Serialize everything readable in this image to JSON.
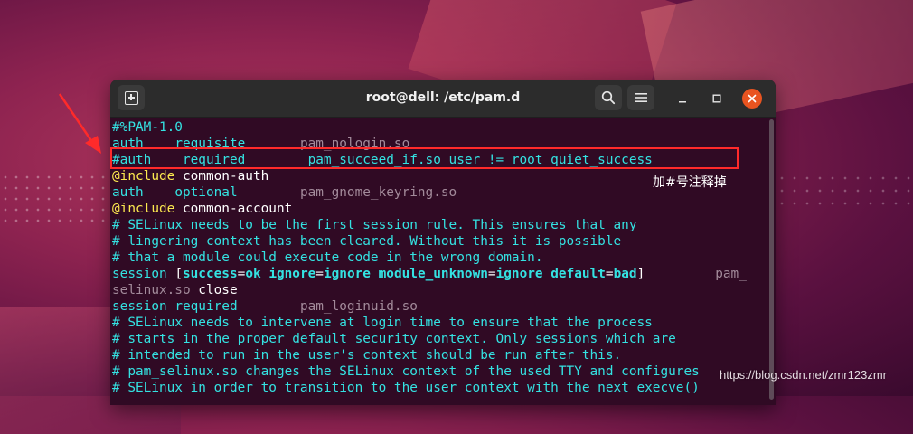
{
  "window": {
    "title": "root@dell: /etc/pam.d"
  },
  "icons": {
    "new_tab": "new-tab-icon",
    "search": "search-icon",
    "menu": "hamburger-menu-icon",
    "minimize": "minimize-icon",
    "maximize": "maximize-icon",
    "close": "close-icon"
  },
  "colors": {
    "terminal_bg": "#300a24",
    "cyan": "#34e2e2",
    "highlight_box": "#ff2a2a",
    "close_button": "#e95420"
  },
  "terminal": {
    "lines": [
      [
        {
          "t": "#%PAM-1.0",
          "c": "comment"
        }
      ],
      [
        {
          "t": "auth    ",
          "c": "kw"
        },
        {
          "t": "requisite       ",
          "c": "kw"
        },
        {
          "t": "pam_nologin.so",
          "c": "dim"
        }
      ],
      [
        {
          "t": "#auth    required        pam_succeed_if.so user != root quiet_success",
          "c": "comment"
        }
      ],
      [
        {
          "t": "@include",
          "c": "yellow"
        },
        {
          "t": " common-auth",
          "c": "white"
        }
      ],
      [
        {
          "t": "auth    ",
          "c": "kw"
        },
        {
          "t": "optional        ",
          "c": "kw"
        },
        {
          "t": "pam_gnome_keyring.so",
          "c": "dim"
        }
      ],
      [
        {
          "t": "@include",
          "c": "yellow"
        },
        {
          "t": " common-account",
          "c": "white"
        }
      ],
      [
        {
          "t": "# SELinux needs to be the first session rule. This ensures that any",
          "c": "comment"
        }
      ],
      [
        {
          "t": "# lingering context has been cleared. Without this it is possible",
          "c": "comment"
        }
      ],
      [
        {
          "t": "# that a module could execute code in the wrong domain.",
          "c": "comment"
        }
      ],
      [
        {
          "t": "session ",
          "c": "kw"
        },
        {
          "t": "[",
          "c": "white"
        },
        {
          "t": "success",
          "c": "kwb"
        },
        {
          "t": "=",
          "c": "white"
        },
        {
          "t": "ok",
          "c": "kwb"
        },
        {
          "t": " ",
          "c": "white"
        },
        {
          "t": "ignore",
          "c": "kwb"
        },
        {
          "t": "=",
          "c": "white"
        },
        {
          "t": "ignore",
          "c": "kwb"
        },
        {
          "t": " ",
          "c": "white"
        },
        {
          "t": "module_unknown",
          "c": "kwb"
        },
        {
          "t": "=",
          "c": "white"
        },
        {
          "t": "ignore",
          "c": "kwb"
        },
        {
          "t": " ",
          "c": "white"
        },
        {
          "t": "default",
          "c": "kwb"
        },
        {
          "t": "=",
          "c": "white"
        },
        {
          "t": "bad",
          "c": "kwb"
        },
        {
          "t": "]",
          "c": "white"
        },
        {
          "t": "         pam_",
          "c": "dim"
        }
      ],
      [
        {
          "t": "selinux.so",
          "c": "dim"
        },
        {
          "t": " close",
          "c": "white"
        }
      ],
      [
        {
          "t": "session ",
          "c": "kw"
        },
        {
          "t": "required        ",
          "c": "kw"
        },
        {
          "t": "pam_loginuid.so",
          "c": "dim"
        }
      ],
      [
        {
          "t": "# SELinux needs to intervene at login time to ensure that the process",
          "c": "comment"
        }
      ],
      [
        {
          "t": "# starts in the proper default security context. Only sessions which are",
          "c": "comment"
        }
      ],
      [
        {
          "t": "# intended to run in the user's context should be run after this.",
          "c": "comment"
        }
      ],
      [
        {
          "t": "# pam_selinux.so changes the SELinux context of the used TTY and configures",
          "c": "comment"
        }
      ],
      [
        {
          "t": "# SELinux in order to transition to the user context with the next execve()",
          "c": "comment"
        }
      ]
    ]
  },
  "annotation": {
    "text": "加#号注释掉"
  },
  "watermark": {
    "text": "https://blog.csdn.net/zmr123zmr"
  }
}
